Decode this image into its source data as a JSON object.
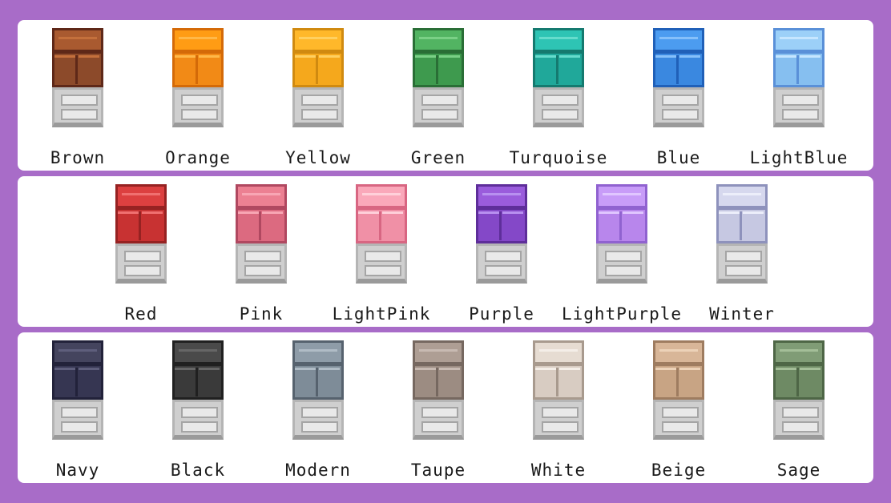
{
  "rows": [
    {
      "items": [
        {
          "label": "Brown",
          "color_mid": "#8c4a2a",
          "color_light": "#a95a30",
          "color_edge": "#5e2818",
          "color_hi": "#c4703c"
        },
        {
          "label": "Orange",
          "color_mid": "#f28a16",
          "color_light": "#ff9c14",
          "color_edge": "#d46a08",
          "color_hi": "#ffb848"
        },
        {
          "label": "Yellow",
          "color_mid": "#f5a81c",
          "color_light": "#ffb82a",
          "color_edge": "#d08a10",
          "color_hi": "#ffd060"
        },
        {
          "label": "Green",
          "color_mid": "#3e9a4e",
          "color_light": "#52b462",
          "color_edge": "#2a6e36",
          "color_hi": "#7ad086"
        },
        {
          "label": "Turquoise",
          "color_mid": "#20a89a",
          "color_light": "#2ec4b4",
          "color_edge": "#157a6f",
          "color_hi": "#66dccc"
        },
        {
          "label": "Blue",
          "color_mid": "#3a88e0",
          "color_light": "#4c9cf0",
          "color_edge": "#2060b8",
          "color_hi": "#86c0fa"
        },
        {
          "label": "LightBlue",
          "color_mid": "#86bff0",
          "color_light": "#9cd0f8",
          "color_edge": "#5a90d8",
          "color_hi": "#c6e6ff"
        }
      ]
    },
    {
      "items": [
        {
          "label": "Red",
          "color_mid": "#c83232",
          "color_light": "#dc4040",
          "color_edge": "#962222",
          "color_hi": "#f07070"
        },
        {
          "label": "Pink",
          "color_mid": "#dc6a80",
          "color_light": "#ec8092",
          "color_edge": "#b04860",
          "color_hi": "#f8a6b4"
        },
        {
          "label": "LightPink",
          "color_mid": "#f090a6",
          "color_light": "#faa8ba",
          "color_edge": "#d86682",
          "color_hi": "#ffd0da"
        },
        {
          "label": "Purple",
          "color_mid": "#8448c8",
          "color_light": "#9a5cdc",
          "color_edge": "#5e2e9a",
          "color_hi": "#b890f0"
        },
        {
          "label": "LightPurple",
          "color_mid": "#b886ec",
          "color_light": "#c89cf8",
          "color_edge": "#9062d0",
          "color_hi": "#e0c6ff"
        },
        {
          "label": "Winter",
          "color_mid": "#c6c8e2",
          "color_light": "#d6d8ee",
          "color_edge": "#8e92bc",
          "color_hi": "#eceefa"
        }
      ]
    },
    {
      "items": [
        {
          "label": "Navy",
          "color_mid": "#363652",
          "color_light": "#44445e",
          "color_edge": "#22223a",
          "color_hi": "#5e5e7c"
        },
        {
          "label": "Black",
          "color_mid": "#3a3a3a",
          "color_light": "#4a4a4a",
          "color_edge": "#202020",
          "color_hi": "#666666"
        },
        {
          "label": "Modern",
          "color_mid": "#7e8c98",
          "color_light": "#8e9ca8",
          "color_edge": "#56626e",
          "color_hi": "#b0bcc6"
        },
        {
          "label": "Taupe",
          "color_mid": "#9c8c82",
          "color_light": "#ae9e94",
          "color_edge": "#766860",
          "color_hi": "#c8bab2"
        },
        {
          "label": "White",
          "color_mid": "#d8ccc2",
          "color_light": "#e6dcd2",
          "color_edge": "#a89a8e",
          "color_hi": "#f4eee8"
        },
        {
          "label": "Beige",
          "color_mid": "#c8a484",
          "color_light": "#d8b698",
          "color_edge": "#9e7c60",
          "color_hi": "#ecd2b8"
        },
        {
          "label": "Sage",
          "color_mid": "#6e8a64",
          "color_light": "#809c76",
          "color_edge": "#4e6646",
          "color_hi": "#a4be98"
        }
      ]
    }
  ]
}
